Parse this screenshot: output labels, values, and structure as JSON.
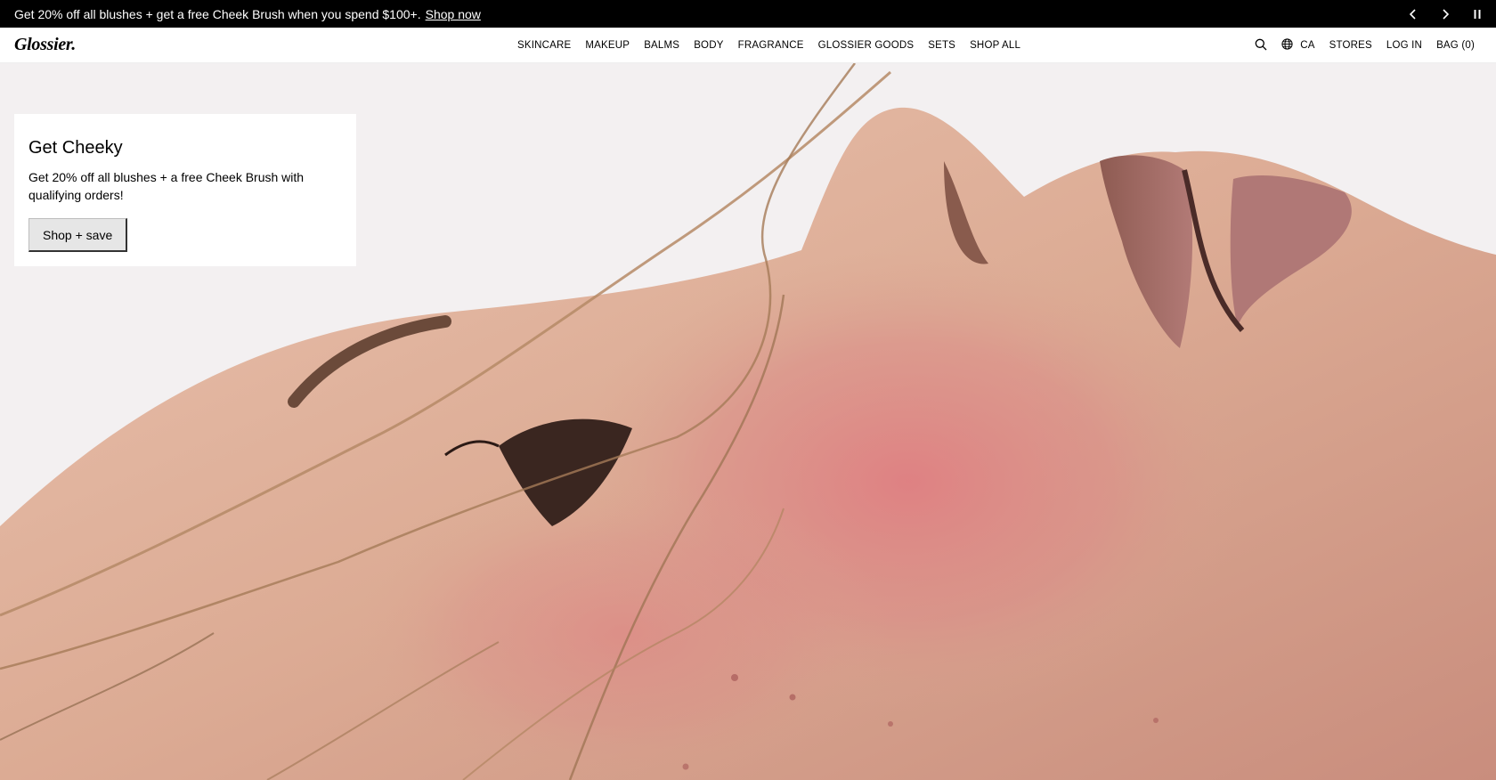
{
  "announcement": {
    "message": "Get 20% off all blushes + get a free Cheek Brush when you spend $100+.",
    "link": "Shop now",
    "prev_icon": "chevron-left-icon",
    "next_icon": "chevron-right-icon",
    "pause_icon": "pause-icon"
  },
  "header": {
    "logo": "Glossier.",
    "menu": [
      "SKINCARE",
      "MAKEUP",
      "BALMS",
      "BODY",
      "FRAGRANCE",
      "GLOSSIER GOODS",
      "SETS",
      "SHOP ALL"
    ],
    "search_icon": "search-icon",
    "globe_icon": "globe-icon",
    "region": "CA",
    "stores": "STORES",
    "login": "LOG IN",
    "bag": "BAG (0)"
  },
  "hero": {
    "title": "Get Cheeky",
    "body": "Get 20% off all blushes + a free Cheek Brush with qualifying orders!",
    "cta": "Shop + save"
  },
  "colors": {
    "announcement_bg": "#000000",
    "skin": "#d9a48f",
    "blush": "#d9787a",
    "backdrop": "#f3f0f1"
  }
}
